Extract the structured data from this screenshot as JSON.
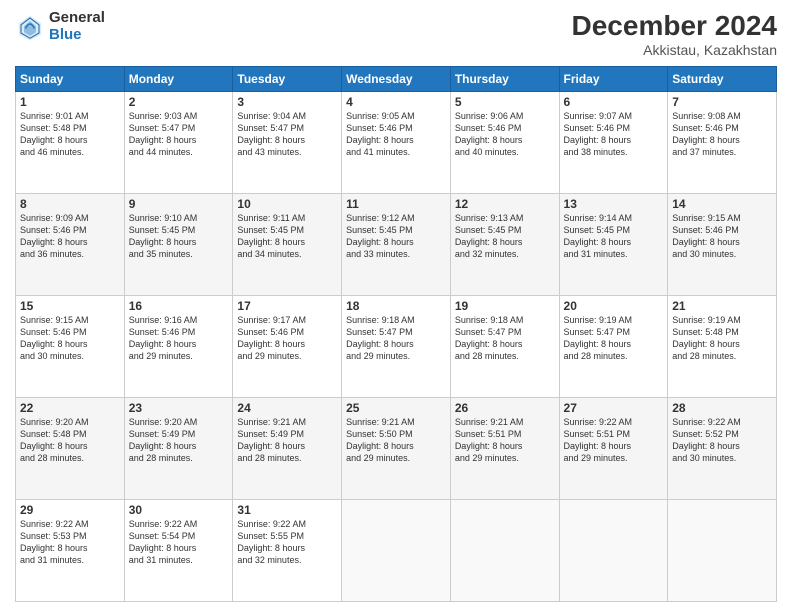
{
  "logo": {
    "general": "General",
    "blue": "Blue"
  },
  "header": {
    "title": "December 2024",
    "subtitle": "Akkistau, Kazakhstan"
  },
  "days_of_week": [
    "Sunday",
    "Monday",
    "Tuesday",
    "Wednesday",
    "Thursday",
    "Friday",
    "Saturday"
  ],
  "weeks": [
    [
      {
        "day": "1",
        "sunrise": "9:01 AM",
        "sunset": "5:48 PM",
        "daylight": "8 hours and 46 minutes."
      },
      {
        "day": "2",
        "sunrise": "9:03 AM",
        "sunset": "5:47 PM",
        "daylight": "8 hours and 44 minutes."
      },
      {
        "day": "3",
        "sunrise": "9:04 AM",
        "sunset": "5:47 PM",
        "daylight": "8 hours and 43 minutes."
      },
      {
        "day": "4",
        "sunrise": "9:05 AM",
        "sunset": "5:46 PM",
        "daylight": "8 hours and 41 minutes."
      },
      {
        "day": "5",
        "sunrise": "9:06 AM",
        "sunset": "5:46 PM",
        "daylight": "8 hours and 40 minutes."
      },
      {
        "day": "6",
        "sunrise": "9:07 AM",
        "sunset": "5:46 PM",
        "daylight": "8 hours and 38 minutes."
      },
      {
        "day": "7",
        "sunrise": "9:08 AM",
        "sunset": "5:46 PM",
        "daylight": "8 hours and 37 minutes."
      }
    ],
    [
      {
        "day": "8",
        "sunrise": "9:09 AM",
        "sunset": "5:46 PM",
        "daylight": "8 hours and 36 minutes."
      },
      {
        "day": "9",
        "sunrise": "9:10 AM",
        "sunset": "5:45 PM",
        "daylight": "8 hours and 35 minutes."
      },
      {
        "day": "10",
        "sunrise": "9:11 AM",
        "sunset": "5:45 PM",
        "daylight": "8 hours and 34 minutes."
      },
      {
        "day": "11",
        "sunrise": "9:12 AM",
        "sunset": "5:45 PM",
        "daylight": "8 hours and 33 minutes."
      },
      {
        "day": "12",
        "sunrise": "9:13 AM",
        "sunset": "5:45 PM",
        "daylight": "8 hours and 32 minutes."
      },
      {
        "day": "13",
        "sunrise": "9:14 AM",
        "sunset": "5:45 PM",
        "daylight": "8 hours and 31 minutes."
      },
      {
        "day": "14",
        "sunrise": "9:15 AM",
        "sunset": "5:46 PM",
        "daylight": "8 hours and 30 minutes."
      }
    ],
    [
      {
        "day": "15",
        "sunrise": "9:15 AM",
        "sunset": "5:46 PM",
        "daylight": "8 hours and 30 minutes."
      },
      {
        "day": "16",
        "sunrise": "9:16 AM",
        "sunset": "5:46 PM",
        "daylight": "8 hours and 29 minutes."
      },
      {
        "day": "17",
        "sunrise": "9:17 AM",
        "sunset": "5:46 PM",
        "daylight": "8 hours and 29 minutes."
      },
      {
        "day": "18",
        "sunrise": "9:18 AM",
        "sunset": "5:47 PM",
        "daylight": "8 hours and 29 minutes."
      },
      {
        "day": "19",
        "sunrise": "9:18 AM",
        "sunset": "5:47 PM",
        "daylight": "8 hours and 28 minutes."
      },
      {
        "day": "20",
        "sunrise": "9:19 AM",
        "sunset": "5:47 PM",
        "daylight": "8 hours and 28 minutes."
      },
      {
        "day": "21",
        "sunrise": "9:19 AM",
        "sunset": "5:48 PM",
        "daylight": "8 hours and 28 minutes."
      }
    ],
    [
      {
        "day": "22",
        "sunrise": "9:20 AM",
        "sunset": "5:48 PM",
        "daylight": "8 hours and 28 minutes."
      },
      {
        "day": "23",
        "sunrise": "9:20 AM",
        "sunset": "5:49 PM",
        "daylight": "8 hours and 28 minutes."
      },
      {
        "day": "24",
        "sunrise": "9:21 AM",
        "sunset": "5:49 PM",
        "daylight": "8 hours and 28 minutes."
      },
      {
        "day": "25",
        "sunrise": "9:21 AM",
        "sunset": "5:50 PM",
        "daylight": "8 hours and 29 minutes."
      },
      {
        "day": "26",
        "sunrise": "9:21 AM",
        "sunset": "5:51 PM",
        "daylight": "8 hours and 29 minutes."
      },
      {
        "day": "27",
        "sunrise": "9:22 AM",
        "sunset": "5:51 PM",
        "daylight": "8 hours and 29 minutes."
      },
      {
        "day": "28",
        "sunrise": "9:22 AM",
        "sunset": "5:52 PM",
        "daylight": "8 hours and 30 minutes."
      }
    ],
    [
      {
        "day": "29",
        "sunrise": "9:22 AM",
        "sunset": "5:53 PM",
        "daylight": "8 hours and 31 minutes."
      },
      {
        "day": "30",
        "sunrise": "9:22 AM",
        "sunset": "5:54 PM",
        "daylight": "8 hours and 31 minutes."
      },
      {
        "day": "31",
        "sunrise": "9:22 AM",
        "sunset": "5:55 PM",
        "daylight": "8 hours and 32 minutes."
      },
      null,
      null,
      null,
      null
    ]
  ]
}
